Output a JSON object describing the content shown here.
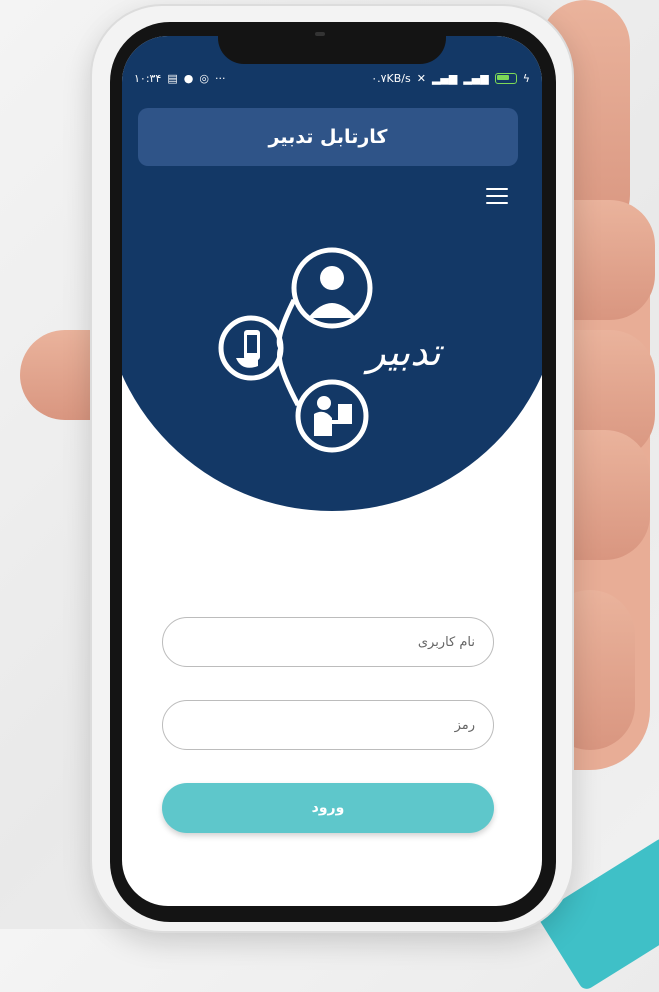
{
  "status_bar": {
    "time": "۱۰:۳۴",
    "speed": "۰.۷KB/s",
    "left_icons": [
      "sim-card-icon",
      "location-icon",
      "sync-icon",
      "more-dots-icon"
    ],
    "right_icons": [
      "vpn-icon",
      "signal-icon",
      "signal-icon",
      "battery-icon"
    ],
    "battery_color": "#7ed957"
  },
  "header": {
    "title": "کارتابل تدبیر",
    "menu_icon": "hamburger-menu-icon"
  },
  "logo": {
    "wordmark": "تدبیر",
    "icons": [
      "user-icon",
      "mobile-phone-icon",
      "person-at-desk-icon"
    ]
  },
  "form": {
    "username_placeholder": "نام کاربری",
    "password_placeholder": "رمز",
    "login_label": "ورود"
  },
  "colors": {
    "primary": "#133866",
    "title_bar": "#2f5488",
    "button": "#5ec7cb",
    "accent": "#3fc0c7"
  }
}
